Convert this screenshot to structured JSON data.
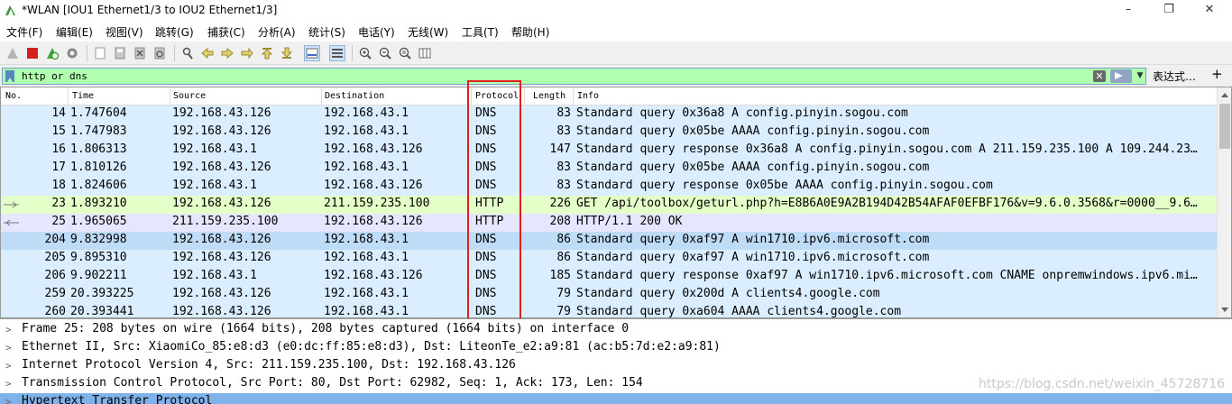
{
  "window": {
    "title": "*WLAN [IOU1 Ethernet1/3 to IOU2 Ethernet1/3]",
    "minimize": "–",
    "maximize": "❐",
    "close": "✕"
  },
  "menu": [
    "文件(F)",
    "编辑(E)",
    "视图(V)",
    "跳转(G)",
    "捕获(C)",
    "分析(A)",
    "统计(S)",
    "电话(Y)",
    "无线(W)",
    "工具(T)",
    "帮助(H)"
  ],
  "toolbar_icons": [
    "shark-fin-start-icon",
    "stop-capture-icon",
    "restart-capture-icon",
    "capture-options-icon",
    "open-file-icon",
    "save-file-icon",
    "close-file-icon",
    "reload-file-icon",
    "find-packet-icon",
    "go-back-icon",
    "go-forward-icon",
    "go-to-packet-icon",
    "first-packet-icon",
    "last-packet-icon",
    "auto-scroll-icon",
    "colorize-icon",
    "zoom-in-icon",
    "zoom-out-icon",
    "normal-size-icon",
    "resize-columns-icon"
  ],
  "filter": {
    "value": "http or dns",
    "expression_label": "表达式…",
    "add_label": "+"
  },
  "columns": {
    "no": "No.",
    "time": "Time",
    "source": "Source",
    "destination": "Destination",
    "protocol": "Protocol",
    "length": "Length",
    "info": "Info"
  },
  "packets": [
    {
      "no": "14",
      "time": "1.747604",
      "src": "192.168.43.126",
      "dst": "192.168.43.1",
      "proto": "DNS",
      "len": "83",
      "info": "Standard query 0x36a8 A config.pinyin.sogou.com"
    },
    {
      "no": "15",
      "time": "1.747983",
      "src": "192.168.43.126",
      "dst": "192.168.43.1",
      "proto": "DNS",
      "len": "83",
      "info": "Standard query 0x05be AAAA config.pinyin.sogou.com"
    },
    {
      "no": "16",
      "time": "1.806313",
      "src": "192.168.43.1",
      "dst": "192.168.43.126",
      "proto": "DNS",
      "len": "147",
      "info": "Standard query response 0x36a8 A config.pinyin.sogou.com A 211.159.235.100 A 109.244.23…"
    },
    {
      "no": "17",
      "time": "1.810126",
      "src": "192.168.43.126",
      "dst": "192.168.43.1",
      "proto": "DNS",
      "len": "83",
      "info": "Standard query 0x05be AAAA config.pinyin.sogou.com"
    },
    {
      "no": "18",
      "time": "1.824606",
      "src": "192.168.43.1",
      "dst": "192.168.43.126",
      "proto": "DNS",
      "len": "83",
      "info": "Standard query response 0x05be AAAA config.pinyin.sogou.com"
    },
    {
      "no": "23",
      "time": "1.893210",
      "src": "192.168.43.126",
      "dst": "211.159.235.100",
      "proto": "HTTP",
      "len": "226",
      "info": "GET /api/toolbox/geturl.php?h=E8B6A0E9A2B194D42B54AFAF0EFBF176&v=9.6.0.3568&r=0000__9.6…"
    },
    {
      "no": "25",
      "time": "1.965065",
      "src": "211.159.235.100",
      "dst": "192.168.43.126",
      "proto": "HTTP",
      "len": "208",
      "info": "HTTP/1.1 200 OK"
    },
    {
      "no": "204",
      "time": "9.832998",
      "src": "192.168.43.126",
      "dst": "192.168.43.1",
      "proto": "DNS",
      "len": "86",
      "info": "Standard query 0xaf97 A win1710.ipv6.microsoft.com"
    },
    {
      "no": "205",
      "time": "9.895310",
      "src": "192.168.43.126",
      "dst": "192.168.43.1",
      "proto": "DNS",
      "len": "86",
      "info": "Standard query 0xaf97 A win1710.ipv6.microsoft.com"
    },
    {
      "no": "206",
      "time": "9.902211",
      "src": "192.168.43.1",
      "dst": "192.168.43.126",
      "proto": "DNS",
      "len": "185",
      "info": "Standard query response 0xaf97 A win1710.ipv6.microsoft.com CNAME onpremwindows.ipv6.mi…"
    },
    {
      "no": "259",
      "time": "20.393225",
      "src": "192.168.43.126",
      "dst": "192.168.43.1",
      "proto": "DNS",
      "len": "79",
      "info": "Standard query 0x200d A clients4.google.com"
    },
    {
      "no": "260",
      "time": "20.393441",
      "src": "192.168.43.126",
      "dst": "192.168.43.1",
      "proto": "DNS",
      "len": "79",
      "info": "Standard query 0xa604 AAAA clients4.google.com"
    }
  ],
  "details": [
    "Frame 25: 208 bytes on wire (1664 bits), 208 bytes captured (1664 bits) on interface 0",
    "Ethernet II, Src: XiaomiCo_85:e8:d3 (e0:dc:ff:85:e8:d3), Dst: LiteonTe_e2:a9:81 (ac:b5:7d:e2:a9:81)",
    "Internet Protocol Version 4, Src: 211.159.235.100, Dst: 192.168.43.126",
    "Transmission Control Protocol, Src Port: 80, Dst Port: 62982, Seq: 1, Ack: 173, Len: 154",
    "Hypertext Transfer Protocol"
  ],
  "watermark": "https://blog.csdn.net/weixin_45728716",
  "colors": {
    "udp_row": "#daeeff",
    "tcp_row": "#e7e6ff",
    "http_request_row": "#e4ffc7",
    "selected_row": "#bfdcf7",
    "filter_ok": "#afffaf",
    "highlight_box": "#e02020"
  }
}
